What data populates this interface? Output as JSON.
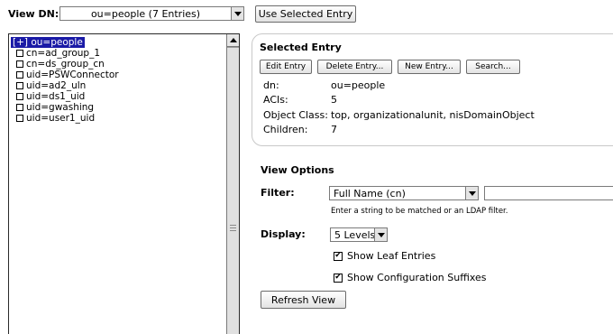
{
  "toolbar": {
    "view_dn_label": "View DN:",
    "view_dn_value": "ou=people (7 Entries)",
    "use_selected_label": "Use Selected Entry"
  },
  "tree": {
    "items": [
      {
        "prefix": "[+]",
        "label": "ou=people",
        "selected": true
      },
      {
        "label": "cn=ad_group_1"
      },
      {
        "label": "cn=ds_group_cn"
      },
      {
        "label": "uid=PSWConnector"
      },
      {
        "label": "uid=ad2_uln"
      },
      {
        "label": "uid=ds1_uid"
      },
      {
        "label": "uid=gwashing"
      },
      {
        "label": "uid=user1_uid"
      }
    ]
  },
  "selected_entry": {
    "title": "Selected Entry",
    "buttons": {
      "edit": "Edit Entry",
      "delete": "Delete Entry...",
      "new": "New Entry...",
      "search": "Search..."
    },
    "fields": [
      {
        "key": "dn:",
        "value": "ou=people"
      },
      {
        "key": "ACIs:",
        "value": "5"
      },
      {
        "key": "Object Class:",
        "value": "top, organizationalunit, nisDomainObject"
      },
      {
        "key": "Children:",
        "value": "7"
      }
    ]
  },
  "view_options": {
    "title": "View Options",
    "filter_label": "Filter:",
    "filter_select_value": "Full Name (cn)",
    "filter_text_value": "",
    "filter_hint": "Enter a string to be matched or an LDAP filter.",
    "display_label": "Display:",
    "display_value": "5 Levels",
    "show_leaf_label": "Show Leaf Entries",
    "show_leaf_checked": true,
    "show_config_label": "Show Configuration Suffixes",
    "show_config_checked": true,
    "refresh_label": "Refresh View"
  },
  "icons": {
    "checkmark": "✔"
  }
}
